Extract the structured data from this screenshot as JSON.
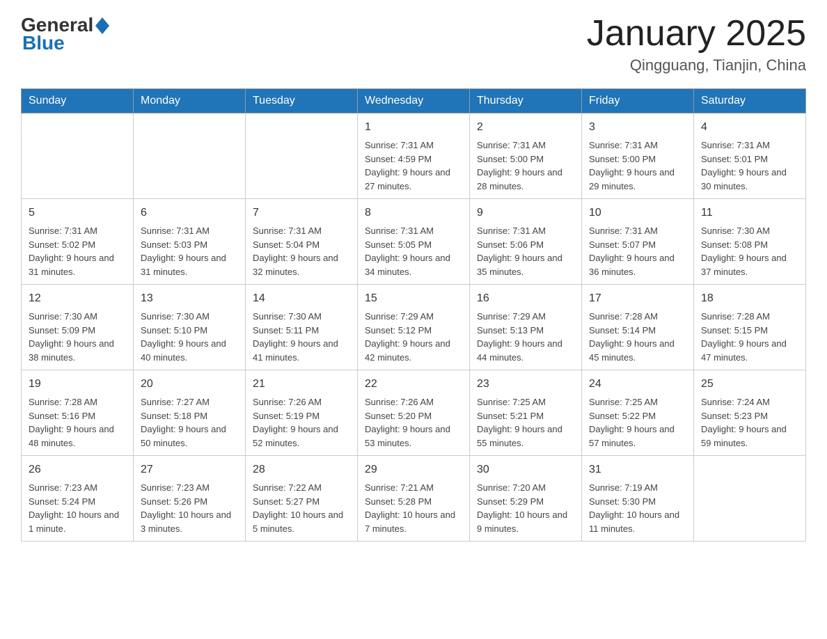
{
  "header": {
    "logo_general": "General",
    "logo_blue": "Blue",
    "title": "January 2025",
    "location": "Qingguang, Tianjin, China"
  },
  "weekdays": [
    "Sunday",
    "Monday",
    "Tuesday",
    "Wednesday",
    "Thursday",
    "Friday",
    "Saturday"
  ],
  "weeks": [
    [
      {
        "day": "",
        "sunrise": "",
        "sunset": "",
        "daylight": ""
      },
      {
        "day": "",
        "sunrise": "",
        "sunset": "",
        "daylight": ""
      },
      {
        "day": "",
        "sunrise": "",
        "sunset": "",
        "daylight": ""
      },
      {
        "day": "1",
        "sunrise": "Sunrise: 7:31 AM",
        "sunset": "Sunset: 4:59 PM",
        "daylight": "Daylight: 9 hours and 27 minutes."
      },
      {
        "day": "2",
        "sunrise": "Sunrise: 7:31 AM",
        "sunset": "Sunset: 5:00 PM",
        "daylight": "Daylight: 9 hours and 28 minutes."
      },
      {
        "day": "3",
        "sunrise": "Sunrise: 7:31 AM",
        "sunset": "Sunset: 5:00 PM",
        "daylight": "Daylight: 9 hours and 29 minutes."
      },
      {
        "day": "4",
        "sunrise": "Sunrise: 7:31 AM",
        "sunset": "Sunset: 5:01 PM",
        "daylight": "Daylight: 9 hours and 30 minutes."
      }
    ],
    [
      {
        "day": "5",
        "sunrise": "Sunrise: 7:31 AM",
        "sunset": "Sunset: 5:02 PM",
        "daylight": "Daylight: 9 hours and 31 minutes."
      },
      {
        "day": "6",
        "sunrise": "Sunrise: 7:31 AM",
        "sunset": "Sunset: 5:03 PM",
        "daylight": "Daylight: 9 hours and 31 minutes."
      },
      {
        "day": "7",
        "sunrise": "Sunrise: 7:31 AM",
        "sunset": "Sunset: 5:04 PM",
        "daylight": "Daylight: 9 hours and 32 minutes."
      },
      {
        "day": "8",
        "sunrise": "Sunrise: 7:31 AM",
        "sunset": "Sunset: 5:05 PM",
        "daylight": "Daylight: 9 hours and 34 minutes."
      },
      {
        "day": "9",
        "sunrise": "Sunrise: 7:31 AM",
        "sunset": "Sunset: 5:06 PM",
        "daylight": "Daylight: 9 hours and 35 minutes."
      },
      {
        "day": "10",
        "sunrise": "Sunrise: 7:31 AM",
        "sunset": "Sunset: 5:07 PM",
        "daylight": "Daylight: 9 hours and 36 minutes."
      },
      {
        "day": "11",
        "sunrise": "Sunrise: 7:30 AM",
        "sunset": "Sunset: 5:08 PM",
        "daylight": "Daylight: 9 hours and 37 minutes."
      }
    ],
    [
      {
        "day": "12",
        "sunrise": "Sunrise: 7:30 AM",
        "sunset": "Sunset: 5:09 PM",
        "daylight": "Daylight: 9 hours and 38 minutes."
      },
      {
        "day": "13",
        "sunrise": "Sunrise: 7:30 AM",
        "sunset": "Sunset: 5:10 PM",
        "daylight": "Daylight: 9 hours and 40 minutes."
      },
      {
        "day": "14",
        "sunrise": "Sunrise: 7:30 AM",
        "sunset": "Sunset: 5:11 PM",
        "daylight": "Daylight: 9 hours and 41 minutes."
      },
      {
        "day": "15",
        "sunrise": "Sunrise: 7:29 AM",
        "sunset": "Sunset: 5:12 PM",
        "daylight": "Daylight: 9 hours and 42 minutes."
      },
      {
        "day": "16",
        "sunrise": "Sunrise: 7:29 AM",
        "sunset": "Sunset: 5:13 PM",
        "daylight": "Daylight: 9 hours and 44 minutes."
      },
      {
        "day": "17",
        "sunrise": "Sunrise: 7:28 AM",
        "sunset": "Sunset: 5:14 PM",
        "daylight": "Daylight: 9 hours and 45 minutes."
      },
      {
        "day": "18",
        "sunrise": "Sunrise: 7:28 AM",
        "sunset": "Sunset: 5:15 PM",
        "daylight": "Daylight: 9 hours and 47 minutes."
      }
    ],
    [
      {
        "day": "19",
        "sunrise": "Sunrise: 7:28 AM",
        "sunset": "Sunset: 5:16 PM",
        "daylight": "Daylight: 9 hours and 48 minutes."
      },
      {
        "day": "20",
        "sunrise": "Sunrise: 7:27 AM",
        "sunset": "Sunset: 5:18 PM",
        "daylight": "Daylight: 9 hours and 50 minutes."
      },
      {
        "day": "21",
        "sunrise": "Sunrise: 7:26 AM",
        "sunset": "Sunset: 5:19 PM",
        "daylight": "Daylight: 9 hours and 52 minutes."
      },
      {
        "day": "22",
        "sunrise": "Sunrise: 7:26 AM",
        "sunset": "Sunset: 5:20 PM",
        "daylight": "Daylight: 9 hours and 53 minutes."
      },
      {
        "day": "23",
        "sunrise": "Sunrise: 7:25 AM",
        "sunset": "Sunset: 5:21 PM",
        "daylight": "Daylight: 9 hours and 55 minutes."
      },
      {
        "day": "24",
        "sunrise": "Sunrise: 7:25 AM",
        "sunset": "Sunset: 5:22 PM",
        "daylight": "Daylight: 9 hours and 57 minutes."
      },
      {
        "day": "25",
        "sunrise": "Sunrise: 7:24 AM",
        "sunset": "Sunset: 5:23 PM",
        "daylight": "Daylight: 9 hours and 59 minutes."
      }
    ],
    [
      {
        "day": "26",
        "sunrise": "Sunrise: 7:23 AM",
        "sunset": "Sunset: 5:24 PM",
        "daylight": "Daylight: 10 hours and 1 minute."
      },
      {
        "day": "27",
        "sunrise": "Sunrise: 7:23 AM",
        "sunset": "Sunset: 5:26 PM",
        "daylight": "Daylight: 10 hours and 3 minutes."
      },
      {
        "day": "28",
        "sunrise": "Sunrise: 7:22 AM",
        "sunset": "Sunset: 5:27 PM",
        "daylight": "Daylight: 10 hours and 5 minutes."
      },
      {
        "day": "29",
        "sunrise": "Sunrise: 7:21 AM",
        "sunset": "Sunset: 5:28 PM",
        "daylight": "Daylight: 10 hours and 7 minutes."
      },
      {
        "day": "30",
        "sunrise": "Sunrise: 7:20 AM",
        "sunset": "Sunset: 5:29 PM",
        "daylight": "Daylight: 10 hours and 9 minutes."
      },
      {
        "day": "31",
        "sunrise": "Sunrise: 7:19 AM",
        "sunset": "Sunset: 5:30 PM",
        "daylight": "Daylight: 10 hours and 11 minutes."
      },
      {
        "day": "",
        "sunrise": "",
        "sunset": "",
        "daylight": ""
      }
    ]
  ]
}
